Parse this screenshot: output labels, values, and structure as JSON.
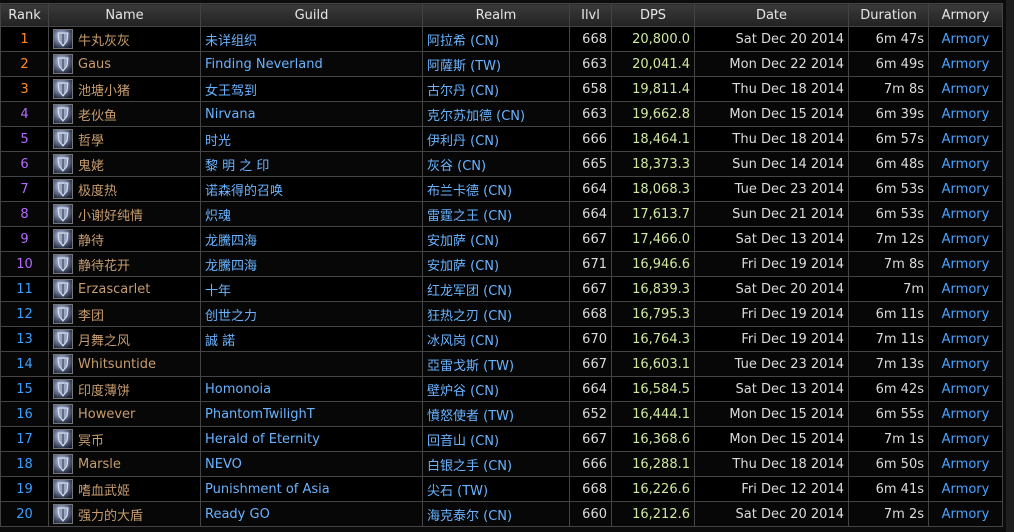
{
  "headers": {
    "rank": "Rank",
    "name": "Name",
    "guild": "Guild",
    "realm": "Realm",
    "ilvl": "Ilvl",
    "dps": "DPS",
    "date": "Date",
    "duration": "Duration",
    "armory": "Armory"
  },
  "colors": {
    "player_name": "#c79c6e",
    "guild": "#69b3ff",
    "realm": "#69b3ff",
    "dps": "#cfe8a0",
    "armory": "#4aa2ff",
    "rank_gradient": [
      "#ff8a2a",
      "#ff8a2a",
      "#ff8a2a",
      "#b56bff",
      "#b56bff",
      "#b56bff",
      "#b56bff",
      "#b56bff",
      "#b56bff",
      "#b56bff",
      "#3aa0ff",
      "#3aa0ff",
      "#3aa0ff",
      "#3aa0ff",
      "#3aa0ff",
      "#3aa0ff",
      "#3aa0ff",
      "#3aa0ff",
      "#3aa0ff",
      "#3aa0ff"
    ]
  },
  "rows": [
    {
      "rank": "1",
      "name": "牛丸灰灰",
      "guild": "未详组织",
      "realm": "阿拉希 (CN)",
      "ilvl": "668",
      "dps": "20,800.0",
      "date": "Sat Dec 20 2014",
      "duration": "6m 47s",
      "armory": "Armory",
      "icon": "warrior-class-icon"
    },
    {
      "rank": "2",
      "name": "Gaus",
      "guild": "Finding Neverland",
      "realm": "阿薩斯 (TW)",
      "ilvl": "663",
      "dps": "20,041.4",
      "date": "Mon Dec 22 2014",
      "duration": "6m 49s",
      "armory": "Armory",
      "icon": "warrior-class-icon"
    },
    {
      "rank": "3",
      "name": "池塘小猪",
      "guild": "女王驾到",
      "realm": "古尔丹 (CN)",
      "ilvl": "658",
      "dps": "19,811.4",
      "date": "Thu Dec 18 2014",
      "duration": "7m 8s",
      "armory": "Armory",
      "icon": "warrior-class-icon"
    },
    {
      "rank": "4",
      "name": "老伙鱼",
      "guild": "Nirvana",
      "realm": "克尔苏加德 (CN)",
      "ilvl": "663",
      "dps": "19,662.8",
      "date": "Mon Dec 15 2014",
      "duration": "6m 39s",
      "armory": "Armory",
      "icon": "warrior-class-icon"
    },
    {
      "rank": "5",
      "name": "哲學",
      "guild": "时光",
      "realm": "伊利丹 (CN)",
      "ilvl": "666",
      "dps": "18,464.1",
      "date": "Thu Dec 18 2014",
      "duration": "6m 57s",
      "armory": "Armory",
      "icon": "warrior-class-icon"
    },
    {
      "rank": "6",
      "name": "鬼姥",
      "guild": "黎 明 之 印",
      "realm": "灰谷 (CN)",
      "ilvl": "665",
      "dps": "18,373.3",
      "date": "Sun Dec 14 2014",
      "duration": "6m 48s",
      "armory": "Armory",
      "icon": "warrior-class-icon"
    },
    {
      "rank": "7",
      "name": "极度热",
      "guild": "诺森得的召唤",
      "realm": "布兰卡德 (CN)",
      "ilvl": "664",
      "dps": "18,068.3",
      "date": "Tue Dec 23 2014",
      "duration": "6m 53s",
      "armory": "Armory",
      "icon": "warrior-class-icon"
    },
    {
      "rank": "8",
      "name": "小谢好纯情",
      "guild": "炽魂",
      "realm": "雷霆之王 (CN)",
      "ilvl": "664",
      "dps": "17,613.7",
      "date": "Sun Dec 21 2014",
      "duration": "6m 53s",
      "armory": "Armory",
      "icon": "warrior-class-icon"
    },
    {
      "rank": "9",
      "name": "静待",
      "guild": "龙騰四海",
      "realm": "安加萨 (CN)",
      "ilvl": "667",
      "dps": "17,466.0",
      "date": "Sat Dec 13 2014",
      "duration": "7m 12s",
      "armory": "Armory",
      "icon": "warrior-class-icon"
    },
    {
      "rank": "10",
      "name": "静待花开",
      "guild": "龙騰四海",
      "realm": "安加萨 (CN)",
      "ilvl": "671",
      "dps": "16,946.6",
      "date": "Fri Dec 19 2014",
      "duration": "7m 8s",
      "armory": "Armory",
      "icon": "warrior-class-icon"
    },
    {
      "rank": "11",
      "name": "Erzascarlet",
      "guild": "十年",
      "realm": "红龙军团 (CN)",
      "ilvl": "667",
      "dps": "16,839.3",
      "date": "Sat Dec 20 2014",
      "duration": "7m",
      "armory": "Armory",
      "icon": "warrior-class-icon"
    },
    {
      "rank": "12",
      "name": "李团",
      "guild": "创世之力",
      "realm": "狂热之刃 (CN)",
      "ilvl": "668",
      "dps": "16,795.3",
      "date": "Fri Dec 19 2014",
      "duration": "6m 11s",
      "armory": "Armory",
      "icon": "warrior-class-icon"
    },
    {
      "rank": "13",
      "name": "月舞之风",
      "guild": "誠 諾",
      "realm": "冰风岗 (CN)",
      "ilvl": "670",
      "dps": "16,764.3",
      "date": "Fri Dec 19 2014",
      "duration": "7m 11s",
      "armory": "Armory",
      "icon": "warrior-class-icon"
    },
    {
      "rank": "14",
      "name": "Whitsuntide",
      "guild": "",
      "realm": "亞雷戈斯 (TW)",
      "ilvl": "667",
      "dps": "16,603.1",
      "date": "Tue Dec 23 2014",
      "duration": "7m 13s",
      "armory": "Armory",
      "icon": "warrior-class-icon"
    },
    {
      "rank": "15",
      "name": "印度薄饼",
      "guild": "Homonoia",
      "realm": "壁炉谷 (CN)",
      "ilvl": "664",
      "dps": "16,584.5",
      "date": "Sat Dec 13 2014",
      "duration": "6m 42s",
      "armory": "Armory",
      "icon": "warrior-class-icon"
    },
    {
      "rank": "16",
      "name": "However",
      "guild": "PhantomTwilighT",
      "realm": "憤怒使者 (TW)",
      "ilvl": "652",
      "dps": "16,444.1",
      "date": "Mon Dec 15 2014",
      "duration": "6m 55s",
      "armory": "Armory",
      "icon": "warrior-class-icon"
    },
    {
      "rank": "17",
      "name": "冥币",
      "guild": "Herald of Eternity",
      "realm": "回音山 (CN)",
      "ilvl": "667",
      "dps": "16,368.6",
      "date": "Mon Dec 15 2014",
      "duration": "7m 1s",
      "armory": "Armory",
      "icon": "warrior-class-icon"
    },
    {
      "rank": "18",
      "name": "Marsle",
      "guild": "NEVO",
      "realm": "白银之手 (CN)",
      "ilvl": "666",
      "dps": "16,288.1",
      "date": "Thu Dec 18 2014",
      "duration": "6m 50s",
      "armory": "Armory",
      "icon": "warrior-class-icon"
    },
    {
      "rank": "19",
      "name": "嗜血武姬",
      "guild": "Punishment of Asia",
      "realm": "尖石 (TW)",
      "ilvl": "668",
      "dps": "16,226.6",
      "date": "Fri Dec 12 2014",
      "duration": "6m 41s",
      "armory": "Armory",
      "icon": "warrior-class-icon"
    },
    {
      "rank": "20",
      "name": "强力的大盾",
      "guild": "Ready GO",
      "realm": "海克泰尔 (CN)",
      "ilvl": "660",
      "dps": "16,212.6",
      "date": "Sat Dec 20 2014",
      "duration": "7m 2s",
      "armory": "Armory",
      "icon": "warrior-class-icon"
    }
  ]
}
